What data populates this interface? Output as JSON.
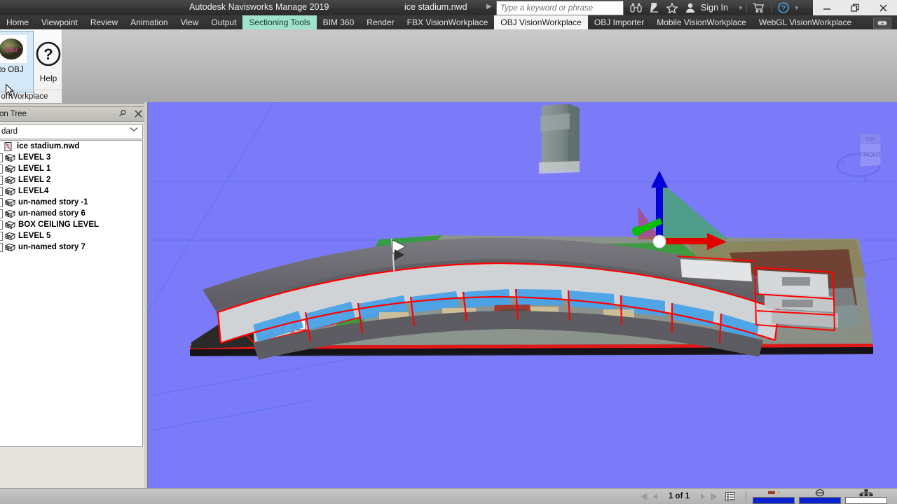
{
  "titlebar": {
    "app_title": "Autodesk Navisworks Manage 2019",
    "document": "ice stadium.nwd",
    "search_placeholder": "Type a keyword or phrase",
    "search_value": "",
    "signin_label": "Sign In",
    "icons": [
      "binoculars-icon",
      "satellite-dish-icon",
      "star-icon",
      "user-icon",
      "cart-icon",
      "help-icon"
    ],
    "window_buttons": [
      "minimize-button",
      "restore-button",
      "close-button"
    ]
  },
  "ribbon": {
    "tabs": [
      {
        "label": "Home",
        "state": "normal"
      },
      {
        "label": "Viewpoint",
        "state": "normal"
      },
      {
        "label": "Review",
        "state": "normal"
      },
      {
        "label": "Animation",
        "state": "normal"
      },
      {
        "label": "View",
        "state": "normal"
      },
      {
        "label": "Output",
        "state": "normal"
      },
      {
        "label": "Sectioning Tools",
        "state": "contextual"
      },
      {
        "label": "BIM 360",
        "state": "normal"
      },
      {
        "label": "Render",
        "state": "normal"
      },
      {
        "label": "FBX VisionWorkplace",
        "state": "normal"
      },
      {
        "label": "OBJ VisionWorkplace",
        "state": "active"
      },
      {
        "label": "OBJ Importer",
        "state": "normal"
      },
      {
        "label": "Mobile VisionWorkplace",
        "state": "normal"
      },
      {
        "label": "WebGL VisionWorkplace",
        "state": "normal"
      }
    ],
    "collapse_icon": "ribbon-collapse-icon",
    "panel": {
      "big_button_label": "to OBJ",
      "big_button_icon": "obj-sphere-icon",
      "help_label": "Help",
      "help_icon": "question-mark-icon",
      "panel_caption": "onWorkplace"
    }
  },
  "selection_tree": {
    "title": "on Tree",
    "pin_icon": "pin-icon",
    "close_icon": "close-icon",
    "mode_value": "dard",
    "mode_caret": "chevron-down-icon",
    "items": [
      {
        "label": "ice stadium.nwd",
        "expandable": false,
        "icon": "file-icon",
        "indent": 0
      },
      {
        "label": "LEVEL 3",
        "expandable": true,
        "icon": "level-icon",
        "indent": 0
      },
      {
        "label": "LEVEL 1",
        "expandable": true,
        "icon": "level-icon",
        "indent": 0
      },
      {
        "label": "LEVEL 2",
        "expandable": true,
        "icon": "level-icon",
        "indent": 0
      },
      {
        "label": "LEVEL4",
        "expandable": true,
        "icon": "level-icon",
        "indent": 0
      },
      {
        "label": "un-named story -1",
        "expandable": true,
        "icon": "level-icon",
        "indent": 0
      },
      {
        "label": "un-named story 6",
        "expandable": true,
        "icon": "level-icon",
        "indent": 0
      },
      {
        "label": "BOX CEILING LEVEL",
        "expandable": true,
        "icon": "level-icon",
        "indent": 0
      },
      {
        "label": "LEVEL 5",
        "expandable": true,
        "icon": "level-icon",
        "indent": 0
      },
      {
        "label": "un-named story 7",
        "expandable": true,
        "icon": "level-icon",
        "indent": 0
      }
    ]
  },
  "viewport": {
    "background_color": "#7b7bfa",
    "gizmo": {
      "name": "section-plane-gizmo",
      "x_axis_color": "#e00000",
      "y_axis_color": "#00c000",
      "z_axis_color": "#0000d8",
      "plane_color": "#2db82d"
    },
    "viewcube": {
      "top_face": "TOP",
      "front_face": "FRONT",
      "compass_west": "W",
      "compass_south": "S"
    },
    "model": {
      "name": "ice-stadium-model",
      "roof_color": "#6b6b70",
      "section_cut_color": "#ff0000",
      "seating_color": "#4aa3e8",
      "lawn_color": "#2f9e32",
      "site_color": "#8d9794"
    }
  },
  "statusbar": {
    "first_icon": "first-page-icon",
    "prev_icon": "previous-page-icon",
    "page_label": "1 of 1",
    "next_icon": "next-page-icon",
    "last_icon": "last-page-icon",
    "list_icon": "list-view-icon",
    "progress": [
      {
        "icon": "pencil-icon",
        "percent": 100
      },
      {
        "icon": "disk-icon",
        "percent": 100
      },
      {
        "icon": "network-icon",
        "percent": 0
      }
    ]
  }
}
